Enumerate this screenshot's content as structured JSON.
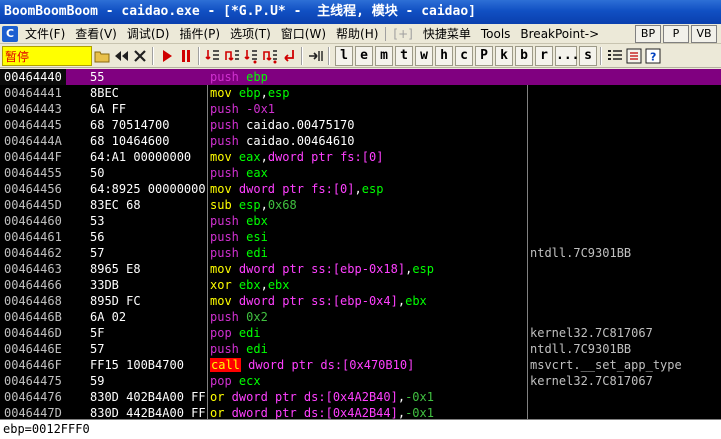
{
  "window": {
    "title": "BoomBoomBoom - caidao.exe - [*G.P.U* -  主线程, 模块 - caidao]"
  },
  "menu": {
    "items": [
      "文件(F)",
      "查看(V)",
      "调试(D)",
      "插件(P)",
      "选项(T)",
      "窗口(W)",
      "帮助(H)"
    ],
    "disabled_item": "[+]",
    "extra_items": [
      "快捷菜单",
      "Tools",
      "BreakPoint->"
    ],
    "right_buttons": [
      "BP",
      "P",
      "VB"
    ]
  },
  "toolbar": {
    "status": "暂停",
    "letters": [
      "l",
      "e",
      "m",
      "t",
      "w",
      "h",
      "c",
      "P",
      "k",
      "b",
      "r",
      "...",
      "s"
    ]
  },
  "disasm": {
    "rows": [
      {
        "addr": "00464440",
        "hex": "55",
        "tokens": [
          [
            "push",
            "t-push"
          ],
          [
            " ebp",
            "t-reg"
          ]
        ],
        "cmt": "",
        "selected": true
      },
      {
        "addr": "00464441",
        "hex": "8BEC",
        "tokens": [
          [
            "mov",
            "t-mov"
          ],
          [
            " ebp",
            "t-reg"
          ],
          [
            ",",
            "t-plain"
          ],
          [
            "esp",
            "t-reg"
          ]
        ],
        "cmt": ""
      },
      {
        "addr": "00464443",
        "hex": "6A FF",
        "tokens": [
          [
            "push",
            "t-push"
          ],
          [
            " -0x1",
            "t-push"
          ]
        ],
        "cmt": ""
      },
      {
        "addr": "00464445",
        "hex": "68 70514700",
        "tokens": [
          [
            "push",
            "t-push"
          ],
          [
            " caidao.00475170",
            "t-plain"
          ]
        ],
        "cmt": ""
      },
      {
        "addr": "0046444A",
        "hex": "68 10464600",
        "tokens": [
          [
            "push",
            "t-push"
          ],
          [
            " caidao.00464610",
            "t-plain"
          ]
        ],
        "cmt": ""
      },
      {
        "addr": "0046444F",
        "hex": "64:A1 00000000",
        "tokens": [
          [
            "mov",
            "t-mov"
          ],
          [
            " eax",
            "t-reg"
          ],
          [
            ",",
            "t-plain"
          ],
          [
            "dword ptr fs:[0]",
            "t-op"
          ]
        ],
        "cmt": ""
      },
      {
        "addr": "00464455",
        "hex": "50",
        "tokens": [
          [
            "push",
            "t-push"
          ],
          [
            " eax",
            "t-reg"
          ]
        ],
        "cmt": ""
      },
      {
        "addr": "00464456",
        "hex": "64:8925 00000000",
        "tokens": [
          [
            "mov",
            "t-mov"
          ],
          [
            " dword ptr fs:[0]",
            "t-op"
          ],
          [
            ",",
            "t-plain"
          ],
          [
            "esp",
            "t-reg"
          ]
        ],
        "cmt": ""
      },
      {
        "addr": "0046445D",
        "hex": "83EC 68",
        "tokens": [
          [
            "sub",
            "t-mov"
          ],
          [
            " esp",
            "t-reg"
          ],
          [
            ",",
            "t-plain"
          ],
          [
            "0x68",
            "t-imm"
          ]
        ],
        "cmt": ""
      },
      {
        "addr": "00464460",
        "hex": "53",
        "tokens": [
          [
            "push",
            "t-push"
          ],
          [
            " ebx",
            "t-reg"
          ]
        ],
        "cmt": ""
      },
      {
        "addr": "00464461",
        "hex": "56",
        "tokens": [
          [
            "push",
            "t-push"
          ],
          [
            " esi",
            "t-reg"
          ]
        ],
        "cmt": ""
      },
      {
        "addr": "00464462",
        "hex": "57",
        "tokens": [
          [
            "push",
            "t-push"
          ],
          [
            " edi",
            "t-reg"
          ]
        ],
        "cmt": "ntdll.7C9301BB"
      },
      {
        "addr": "00464463",
        "hex": "8965 E8",
        "tokens": [
          [
            "mov",
            "t-mov"
          ],
          [
            " dword ptr ss:[ebp-0x18]",
            "t-op"
          ],
          [
            ",",
            "t-plain"
          ],
          [
            "esp",
            "t-reg"
          ]
        ],
        "cmt": ""
      },
      {
        "addr": "00464466",
        "hex": "33DB",
        "tokens": [
          [
            "xor",
            "t-mov"
          ],
          [
            " ebx",
            "t-reg"
          ],
          [
            ",",
            "t-plain"
          ],
          [
            "ebx",
            "t-reg"
          ]
        ],
        "cmt": ""
      },
      {
        "addr": "00464468",
        "hex": "895D FC",
        "tokens": [
          [
            "mov",
            "t-mov"
          ],
          [
            " dword ptr ss:[ebp-0x4]",
            "t-op"
          ],
          [
            ",",
            "t-plain"
          ],
          [
            "ebx",
            "t-reg"
          ]
        ],
        "cmt": ""
      },
      {
        "addr": "0046446B",
        "hex": "6A 02",
        "tokens": [
          [
            "push",
            "t-push"
          ],
          [
            " 0x2",
            "t-imm"
          ]
        ],
        "cmt": ""
      },
      {
        "addr": "0046446D",
        "hex": "5F",
        "tokens": [
          [
            "pop",
            "t-push"
          ],
          [
            " edi",
            "t-reg"
          ]
        ],
        "cmt": "kernel32.7C817067"
      },
      {
        "addr": "0046446E",
        "hex": "57",
        "tokens": [
          [
            "push",
            "t-push"
          ],
          [
            " edi",
            "t-reg"
          ]
        ],
        "cmt": "ntdll.7C9301BB"
      },
      {
        "addr": "0046446F",
        "hex": "FF15 100B4700",
        "tokens": [
          [
            "call",
            "t-call"
          ],
          [
            " dword ptr ds:[0x470B10]",
            "t-op"
          ]
        ],
        "cmt": "msvcrt.__set_app_type"
      },
      {
        "addr": "00464475",
        "hex": "59",
        "tokens": [
          [
            "pop",
            "t-push"
          ],
          [
            " ecx",
            "t-reg"
          ]
        ],
        "cmt": "kernel32.7C817067"
      },
      {
        "addr": "00464476",
        "hex": "830D 402B4A00 FF",
        "tokens": [
          [
            "or",
            "t-mov"
          ],
          [
            " dword ptr ds:[0x4A2B40]",
            "t-op"
          ],
          [
            ",",
            "t-plain"
          ],
          [
            "-0x1",
            "t-imm"
          ]
        ],
        "cmt": ""
      },
      {
        "addr": "0046447D",
        "hex": "830D 442B4A00 FF",
        "tokens": [
          [
            "or",
            "t-mov"
          ],
          [
            " dword ptr ds:[0x4A2B44]",
            "t-op"
          ],
          [
            ",",
            "t-plain"
          ],
          [
            "-0x1",
            "t-imm"
          ]
        ],
        "cmt": ""
      }
    ]
  },
  "status_line": "ebp=0012FFF0"
}
